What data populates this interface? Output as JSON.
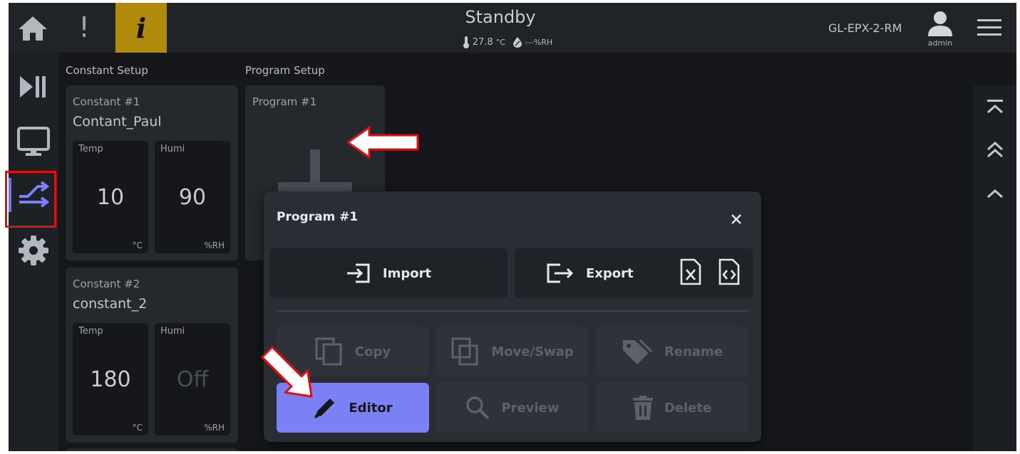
{
  "header": {
    "status_title": "Standby",
    "temperature": "27.8",
    "temperature_unit": "°C",
    "humidity": "---%RH",
    "device_name": "GL-EPX-2-RM",
    "user_name": "admin",
    "info_glyph": "i",
    "alert_glyph": "!"
  },
  "sidebar": {
    "items": [
      {
        "name": "run-pause",
        "icon": "play-pause-icon"
      },
      {
        "name": "monitor",
        "icon": "monitor-icon"
      },
      {
        "name": "program",
        "icon": "program-arrows-icon",
        "active": true
      },
      {
        "name": "settings",
        "icon": "gear-icon"
      }
    ],
    "active_color": "#6d7bd8"
  },
  "sections": {
    "constant_label": "Constant Setup",
    "program_label": "Program Setup"
  },
  "constants": [
    {
      "number": "Constant #1",
      "name": "Contant_Paul",
      "temp_label": "Temp",
      "temp_value": "10",
      "temp_unit": "°C",
      "humi_label": "Humi",
      "humi_value": "90",
      "humi_unit": "%RH"
    },
    {
      "number": "Constant #2",
      "name": "constant_2",
      "temp_label": "Temp",
      "temp_value": "180",
      "temp_unit": "°C",
      "humi_label": "Humi",
      "humi_value": "Off",
      "humi_unit": "%RH"
    }
  ],
  "program_card": {
    "title": "Program #1"
  },
  "dialog": {
    "title": "Program #1",
    "import_label": "Import",
    "export_label": "Export",
    "copy_label": "Copy",
    "move_label": "Move/Swap",
    "rename_label": "Rename",
    "editor_label": "Editor",
    "preview_label": "Preview",
    "delete_label": "Delete"
  },
  "colors": {
    "accent": "#7b80f4",
    "info_bg": "#b08a0a",
    "annotation_red": "#e01010"
  }
}
